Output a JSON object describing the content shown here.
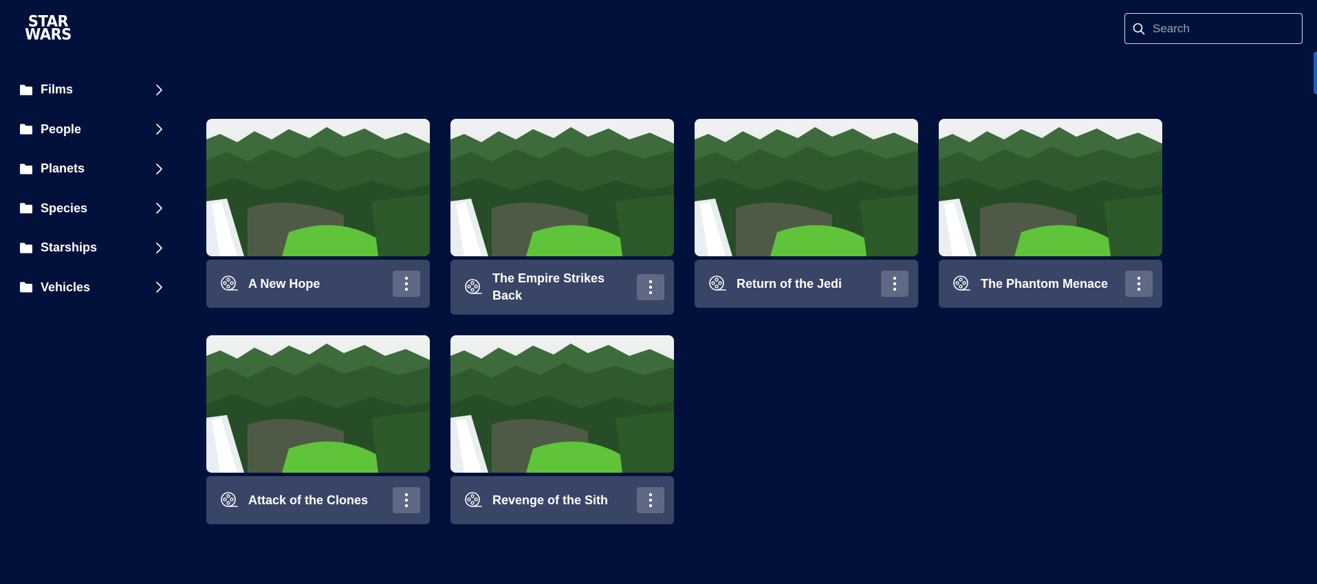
{
  "logo": {
    "line1": "STAR",
    "line2": "WARS"
  },
  "search": {
    "placeholder": "Search",
    "icon": "search-icon"
  },
  "sidebar": {
    "items": [
      {
        "label": "Films",
        "icon": "folder-icon"
      },
      {
        "label": "People",
        "icon": "folder-icon"
      },
      {
        "label": "Planets",
        "icon": "folder-icon"
      },
      {
        "label": "Species",
        "icon": "folder-icon"
      },
      {
        "label": "Starships",
        "icon": "folder-icon"
      },
      {
        "label": "Vehicles",
        "icon": "folder-icon"
      }
    ]
  },
  "films": [
    {
      "title": "A New Hope",
      "icon": "film-reel-icon"
    },
    {
      "title": "The Empire Strikes Back",
      "icon": "film-reel-icon"
    },
    {
      "title": "Return of the Jedi",
      "icon": "film-reel-icon"
    },
    {
      "title": "The Phantom Menace",
      "icon": "film-reel-icon"
    },
    {
      "title": "Attack of the Clones",
      "icon": "film-reel-icon"
    },
    {
      "title": "Revenge of the Sith",
      "icon": "film-reel-icon"
    }
  ],
  "colors": {
    "background": "#02113b",
    "card": "#394566",
    "menu_button": "#5f6985",
    "accent": "#1d5fbd"
  }
}
